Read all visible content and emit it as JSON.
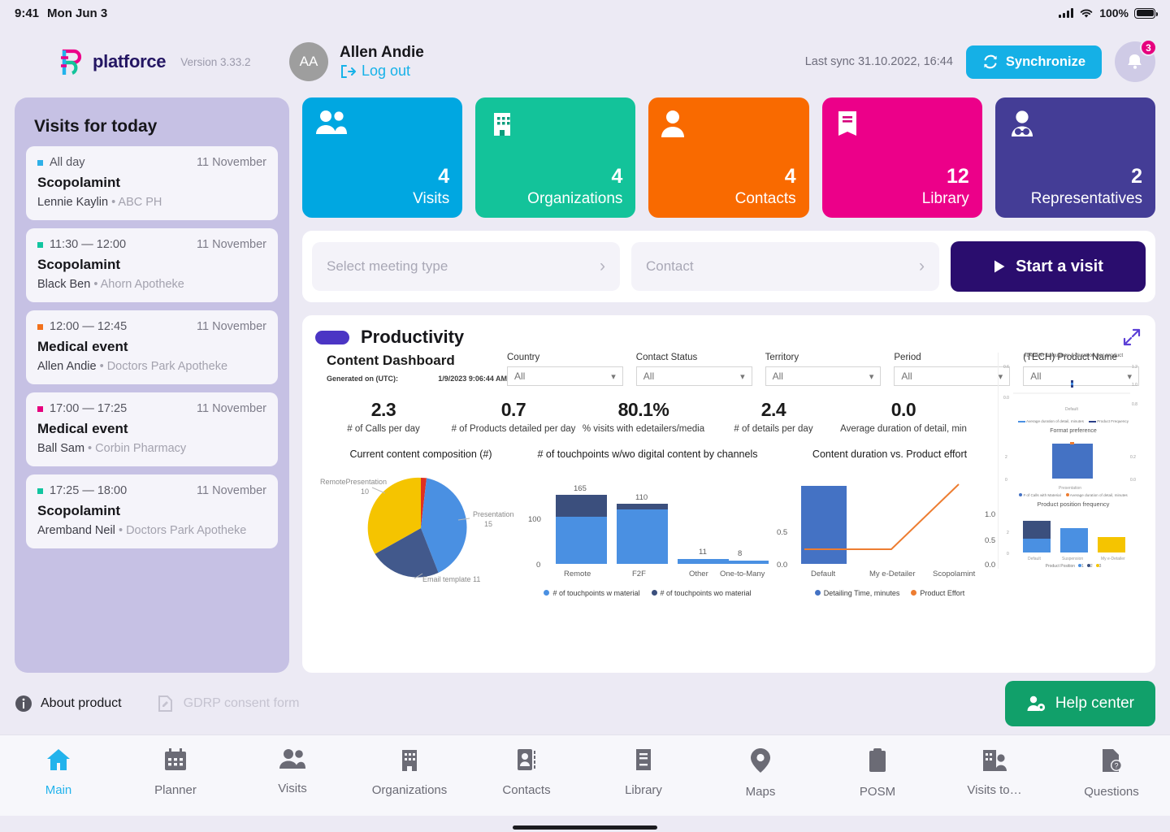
{
  "status_bar": {
    "time": "9:41",
    "date": "Mon Jun 3",
    "battery": "100%"
  },
  "header": {
    "brand": "platforce",
    "version": "Version 3.33.2",
    "avatar_initials": "AA",
    "user_name": "Allen Andie",
    "logout_label": "Log out",
    "last_sync": "Last sync 31.10.2022, 16:44",
    "sync_label": "Synchronize",
    "notification_count": "3"
  },
  "sidebar": {
    "title": "Visits for today",
    "visits": [
      {
        "time": "All day",
        "date": "11 November",
        "title": "Scopolamint",
        "contact": "Lennie Kaylin",
        "org": "ABC PH",
        "color": "#2fb0e8"
      },
      {
        "time": "11:30 — 12:00",
        "date": "11 November",
        "title": "Scopolamint",
        "contact": "Black Ben",
        "org": "Ahorn Apotheke",
        "color": "#12c5a0"
      },
      {
        "time": "12:00 — 12:45",
        "date": "11 November",
        "title": "Medical event",
        "contact": "Allen Andie",
        "org": "Doctors Park Apotheke",
        "color": "#f2711c"
      },
      {
        "time": "17:00 — 17:25",
        "date": "11 November",
        "title": "Medical event",
        "contact": "Ball Sam",
        "org": "Corbin Pharmacy",
        "color": "#e6007e"
      },
      {
        "time": "17:25 — 18:00",
        "date": "11 November",
        "title": "Scopolamint",
        "contact": "Aremband Neil",
        "org": "Doctors Park Apotheke",
        "color": "#12c5a0"
      }
    ]
  },
  "stat_cards": [
    {
      "icon": "people-icon",
      "value": "4",
      "label": "Visits",
      "color": "#00a7e1"
    },
    {
      "icon": "building-icon",
      "value": "4",
      "label": "Organizations",
      "color": "#13c39a"
    },
    {
      "icon": "person-icon",
      "value": "4",
      "label": "Contacts",
      "color": "#f96a00"
    },
    {
      "icon": "book-icon",
      "value": "12",
      "label": "Library",
      "color": "#ec0089"
    },
    {
      "icon": "representative-icon",
      "value": "2",
      "label": "Representatives",
      "color": "#443d96"
    }
  ],
  "visit_bar": {
    "meeting_type_placeholder": "Select meeting type",
    "contact_placeholder": "Contact",
    "start_label": "Start a visit"
  },
  "productivity": {
    "title": "Productivity",
    "dashboard_title": "Content Dashboard",
    "generated_label": "Generated on (UTC):",
    "generated_value": "1/9/2023 9:06:44 AM",
    "filters": [
      {
        "label": "Country",
        "value": "All"
      },
      {
        "label": "Contact Status",
        "value": "All"
      },
      {
        "label": "Territory",
        "value": "All"
      },
      {
        "label": "Period",
        "value": "All"
      },
      {
        "label": "(TECH) Product Name",
        "value": "All"
      }
    ],
    "kpis": [
      {
        "value": "2.3",
        "label": "# of Calls per day"
      },
      {
        "value": "0.7",
        "label": "# of Products detailed per day"
      },
      {
        "value": "80.1%",
        "label": "% visits with edetailers/media"
      },
      {
        "value": "2.4",
        "label": "# of details per day"
      },
      {
        "value": "0.0",
        "label": "Average duration of detail, min"
      }
    ]
  },
  "chart_data": [
    {
      "type": "pie",
      "title": "Current content composition (#)",
      "categories": [
        "Presentation",
        "Email template",
        "RemotePresentation",
        "Other"
      ],
      "values": [
        15,
        11,
        10,
        1
      ],
      "colors": [
        "#4a90e2",
        "#42598c",
        "#f5c400",
        "#e03020"
      ],
      "labels": [
        "Presentation\n15",
        "Email template 11",
        "RemotePresentation\n10",
        ""
      ],
      "legend": "none"
    },
    {
      "type": "bar",
      "title": "# of touchpoints w/wo digital content by channels",
      "categories": [
        "Remote",
        "F2F",
        "Other",
        "One-to-Many"
      ],
      "totals": [
        165,
        110,
        11,
        8
      ],
      "series": [
        {
          "name": "# of touchpoints w material",
          "values": [
            126,
            101,
            11,
            8
          ],
          "color": "#4a90e2"
        },
        {
          "name": "# of touchpoints wo material",
          "values": [
            39,
            9,
            0,
            0
          ],
          "color": "#3b4f7d"
        }
      ],
      "ylim": [
        0,
        180
      ],
      "yticks": [
        "0",
        "100"
      ],
      "stacked": true,
      "legend": "bottom"
    },
    {
      "type": "bar-line",
      "title": "Content duration vs. Product effort",
      "categories": [
        "Default",
        "My e-Detailer",
        "Scopolamint"
      ],
      "series": [
        {
          "name": "Detailing Time, minutes",
          "values": [
            0.85,
            0,
            0
          ],
          "color": "#4472c4",
          "axis": "left"
        },
        {
          "name": "Product Effort",
          "values": [
            0.3,
            0.3,
            1.3
          ],
          "color": "#ed7d31",
          "axis": "right"
        }
      ],
      "yticks_left": [
        "0.0",
        "0.5"
      ],
      "yticks_right": [
        "0.0",
        "0.5",
        "1.0"
      ],
      "legend": "bottom"
    },
    {
      "type": "scatter",
      "title": "eDetailer frequency & duration per product",
      "categories": [
        "Default"
      ],
      "series": [
        {
          "name": "Average duration of detail, minutes",
          "values": [
            0.5
          ],
          "color": "#4a90e2"
        },
        {
          "name": "Product Frequency",
          "values": [
            1.0
          ],
          "color": "#2b3f87"
        }
      ],
      "yticks_left": [
        "0.0",
        "0.5"
      ],
      "yticks_right": [
        "0.0",
        "1.0",
        "1.2"
      ],
      "legend": "bottom"
    },
    {
      "type": "bar",
      "title": "Format preference",
      "categories": [
        "Presentation"
      ],
      "series": [
        {
          "name": "# of Calls with Material",
          "values": [
            2
          ],
          "color": "#4472c4"
        },
        {
          "name": "Average duration of detail, minutes",
          "values": [
            0.02
          ],
          "color": "#ed7d31"
        }
      ],
      "yticks_left": [
        "0",
        "2"
      ],
      "yticks_right": [
        "0.0",
        "0.2"
      ],
      "legend": "bottom"
    },
    {
      "type": "bar",
      "title": "Product position frequency",
      "categories": [
        "Default",
        "Suspension",
        "My e-Detailer"
      ],
      "series": [
        {
          "name": "1",
          "values": [
            1,
            2,
            0
          ],
          "color": "#4a90e2"
        },
        {
          "name": "2",
          "values": [
            1.3,
            0,
            0
          ],
          "color": "#3b4f7d"
        },
        {
          "name": "3",
          "values": [
            0,
            0,
            1.1
          ],
          "color": "#f5c400"
        }
      ],
      "legend_title": "Product Position",
      "yticks": [
        "0",
        "2"
      ],
      "stacked": true,
      "legend": "bottom"
    }
  ],
  "footer": {
    "about_label": "About product",
    "gdpr_label": "GDRP consent form",
    "help_label": "Help center"
  },
  "tabbar": {
    "items": [
      {
        "label": "Main",
        "icon": "home-icon",
        "active": true
      },
      {
        "label": "Planner",
        "icon": "calendar-icon",
        "active": false
      },
      {
        "label": "Visits",
        "icon": "people-icon",
        "active": false
      },
      {
        "label": "Organizations",
        "icon": "building-icon",
        "active": false
      },
      {
        "label": "Contacts",
        "icon": "contact-card-icon",
        "active": false
      },
      {
        "label": "Library",
        "icon": "book-icon",
        "active": false
      },
      {
        "label": "Maps",
        "icon": "map-pin-icon",
        "active": false
      },
      {
        "label": "POSM",
        "icon": "clipboard-icon",
        "active": false
      },
      {
        "label": "Visits to…",
        "icon": "building-person-icon",
        "active": false
      },
      {
        "label": "Questions",
        "icon": "document-question-icon",
        "active": false
      }
    ]
  }
}
